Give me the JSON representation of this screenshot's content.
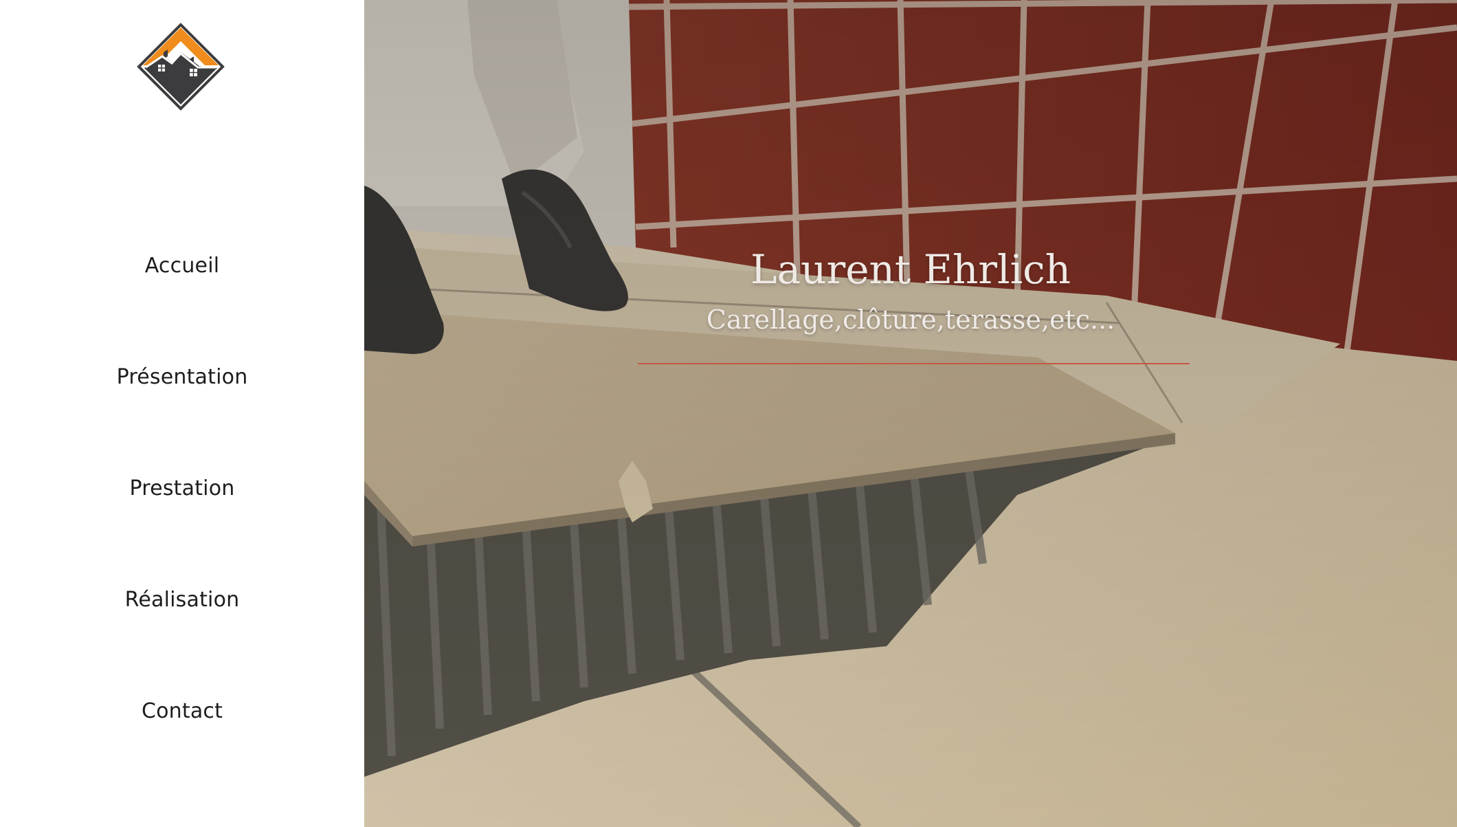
{
  "logo": {
    "icon": "house-roof-logo-icon",
    "accent_color": "#ef8c1c",
    "dark_color": "#3c3c3e"
  },
  "nav": {
    "items": [
      {
        "label": "Accueil"
      },
      {
        "label": "Présentation"
      },
      {
        "label": "Prestation"
      },
      {
        "label": "Réalisation"
      },
      {
        "label": "Contact"
      }
    ]
  },
  "hero": {
    "title": "Laurent Ehrlich",
    "subtitle": "Carellage,clôture,terasse,etc...",
    "divider_color": "#c35a44"
  }
}
